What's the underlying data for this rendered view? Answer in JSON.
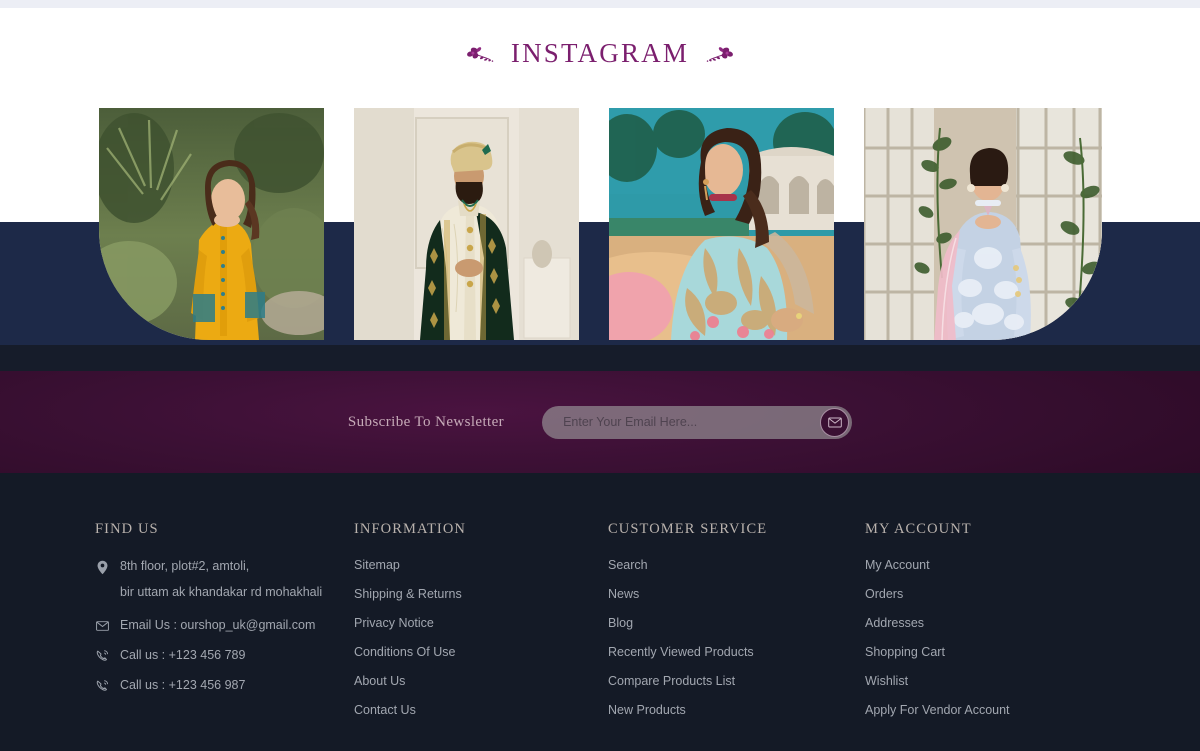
{
  "instagram": {
    "heading": "INSTAGRAM",
    "ornament_left": "floral-ornament-icon",
    "ornament_right": "floral-ornament-icon",
    "posts": [
      {
        "alt": "Woman in yellow embroidered kurta standing in a garden",
        "shape": "rounded-bottom-left"
      },
      {
        "alt": "Man in cream sherwani with dark green embroidered shawl and gold turban",
        "shape": "rectangle"
      },
      {
        "alt": "Woman in pastel blue and gold embroidered gown seated outdoors",
        "shape": "rectangle"
      },
      {
        "alt": "Woman in light blue embellished suit with pink dupatta by tall windows",
        "shape": "rounded-bottom-right"
      }
    ]
  },
  "newsletter": {
    "label": "Subscribe To Newsletter",
    "placeholder": "Enter Your Email Here...",
    "value": "",
    "submit_icon": "envelope-icon"
  },
  "footer": {
    "find_us": {
      "heading": "FIND US",
      "address_line1": "8th floor, plot#2, amtoli,",
      "address_line2": "bir uttam ak khandakar rd mohakhali",
      "email": "Email Us : ourshop_uk@gmail.com",
      "phone1": "Call us :  +123 456 789",
      "phone2": "Call us :  +123 456 987",
      "icons": {
        "address": "map-pin-icon",
        "email": "envelope-icon",
        "phone": "phone-call-icon"
      }
    },
    "information": {
      "heading": "INFORMATION",
      "links": [
        "Sitemap",
        "Shipping & Returns",
        "Privacy Notice",
        "Conditions Of Use",
        "About Us",
        "Contact Us"
      ]
    },
    "customer_service": {
      "heading": "CUSTOMER SERVICE",
      "links": [
        "Search",
        "News",
        "Blog",
        "Recently Viewed Products",
        "Compare Products List",
        "New Products"
      ]
    },
    "my_account": {
      "heading": "MY ACCOUNT",
      "links": [
        "My Account",
        "Orders",
        "Addresses",
        "Shopping Cart",
        "Wishlist",
        "Apply For Vendor Account"
      ]
    }
  },
  "colors": {
    "accent_purple": "#7b1f6e",
    "navy_band": "#1d2948",
    "navy_dark_band": "#161c2a",
    "newsletter_purple": "#3b1034",
    "footer_bg": "#141a26",
    "footer_link": "#a2a7b0",
    "footer_heading": "#b9b2ad"
  }
}
